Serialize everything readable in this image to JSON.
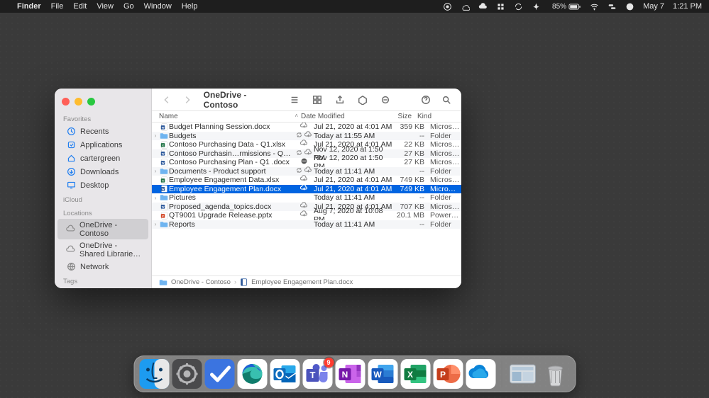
{
  "menubar": {
    "app": "Finder",
    "items": [
      "File",
      "Edit",
      "View",
      "Go",
      "Window",
      "Help"
    ],
    "battery_pct": "85%",
    "date": "May 7",
    "time": "1:21 PM"
  },
  "window": {
    "title": "OneDrive - Contoso",
    "columns": {
      "name": "Name",
      "mod": "Date Modified",
      "size": "Size",
      "kind": "Kind"
    },
    "sidebar": {
      "sections": [
        {
          "label": "Favorites",
          "items": [
            {
              "icon": "clock",
              "label": "Recents"
            },
            {
              "icon": "app",
              "label": "Applications"
            },
            {
              "icon": "house",
              "label": "cartergreen"
            },
            {
              "icon": "down",
              "label": "Downloads"
            },
            {
              "icon": "desk",
              "label": "Desktop"
            }
          ]
        },
        {
          "label": "iCloud",
          "items": []
        },
        {
          "label": "Locations",
          "items": [
            {
              "icon": "cloud",
              "label": "OneDrive - Contoso",
              "selected": true
            },
            {
              "icon": "cloud",
              "label": "OneDrive - Shared Librarie…"
            },
            {
              "icon": "globe",
              "label": "Network"
            }
          ]
        },
        {
          "label": "Tags",
          "items": []
        }
      ]
    },
    "files": [
      {
        "type": "word",
        "expandable": false,
        "name": "Budget Planning Session.docx",
        "cloud": "cloud",
        "mod": "Jul 21, 2020 at 4:01 AM",
        "size": "359 KB",
        "kind": "Micros…(."
      },
      {
        "type": "folder",
        "expandable": true,
        "name": "Budgets",
        "cloud": "sync",
        "mod": "Today at 11:55 AM",
        "size": "--",
        "kind": "Folder"
      },
      {
        "type": "excel",
        "expandable": false,
        "name": "Contoso Purchasing Data - Q1.xlsx",
        "cloud": "cloud",
        "mod": "Jul 21, 2020 at 4:01 AM",
        "size": "22 KB",
        "kind": "Micros…k"
      },
      {
        "type": "word",
        "expandable": false,
        "name": "Contoso Purchasin…rmissions - Q1.docx",
        "cloud": "sync",
        "mod": "Nov 12, 2020 at 1:50 PM",
        "size": "27 KB",
        "kind": "Micros…(."
      },
      {
        "type": "word",
        "expandable": false,
        "name": "Contoso Purchasing Plan - Q1 .docx",
        "cloud": "blocked",
        "mod": "Nov 12, 2020 at 1:50 PM",
        "size": "27 KB",
        "kind": "Micros…(."
      },
      {
        "type": "folder",
        "expandable": true,
        "name": "Documents - Product support",
        "cloud": "sync",
        "mod": "Today at 11:41 AM",
        "size": "--",
        "kind": "Folder"
      },
      {
        "type": "excel",
        "expandable": false,
        "name": "Employee Engagement Data.xlsx",
        "cloud": "cloud",
        "mod": "Jul 21, 2020 at 4:01 AM",
        "size": "749 KB",
        "kind": "Micros…k"
      },
      {
        "type": "word",
        "expandable": false,
        "name": "Employee Engagement Plan.docx",
        "cloud": "cloud",
        "mod": "Jul 21, 2020 at 4:01 AM",
        "size": "749 KB",
        "kind": "Micro…(…",
        "selected": true
      },
      {
        "type": "folder",
        "expandable": true,
        "name": "Pictures",
        "cloud": "",
        "mod": "Today at 11:41 AM",
        "size": "--",
        "kind": "Folder"
      },
      {
        "type": "word",
        "expandable": false,
        "name": "Proposed_agenda_topics.docx",
        "cloud": "cloud",
        "mod": "Jul 21, 2020 at 4:01 AM",
        "size": "707 KB",
        "kind": "Micros…(."
      },
      {
        "type": "ppt",
        "expandable": false,
        "name": "QT9001 Upgrade Release.pptx",
        "cloud": "cloud",
        "mod": "Aug 7, 2020 at 10:08 PM",
        "size": "20.1 MB",
        "kind": "PowerP…"
      },
      {
        "type": "folder",
        "expandable": true,
        "name": "Reports",
        "cloud": "",
        "mod": "Today at 11:41 AM",
        "size": "--",
        "kind": "Folder"
      }
    ],
    "path": [
      "OneDrive - Contoso",
      "Employee Engagement Plan.docx"
    ]
  },
  "dock": {
    "items": [
      {
        "name": "finder",
        "bg": "#1d9bf0"
      },
      {
        "name": "settings",
        "bg": "#4a4a4c"
      },
      {
        "name": "todo",
        "bg": "#3b74e0"
      },
      {
        "name": "edge",
        "bg": "#ffffff"
      },
      {
        "name": "outlook",
        "bg": "#ffffff"
      },
      {
        "name": "teams",
        "bg": "#ffffff",
        "badge": "9"
      },
      {
        "name": "onenote",
        "bg": "#ffffff"
      },
      {
        "name": "word",
        "bg": "#ffffff"
      },
      {
        "name": "excel",
        "bg": "#ffffff"
      },
      {
        "name": "powerpoint",
        "bg": "#ffffff"
      },
      {
        "name": "onedrive",
        "bg": "#ffffff"
      }
    ],
    "right": [
      {
        "name": "downloads"
      },
      {
        "name": "trash"
      }
    ]
  }
}
